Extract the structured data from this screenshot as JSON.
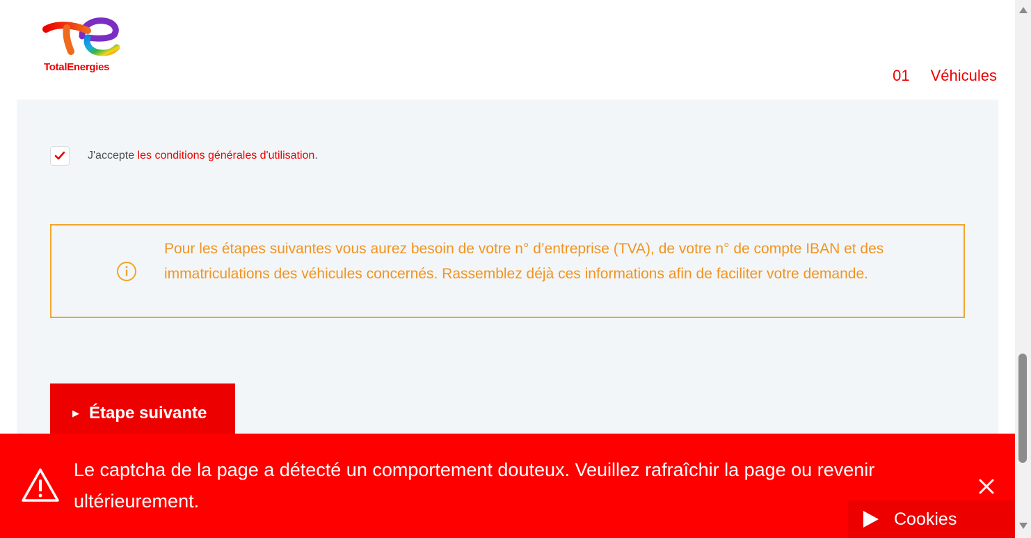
{
  "brand": {
    "name": "TotalEnergies",
    "color": "#ed0000"
  },
  "header": {
    "step_number": "01",
    "step_label": "Véhicules"
  },
  "terms": {
    "checked": true,
    "prefix": "J'accepte ",
    "link_text": "les conditions générales d'utilisation",
    "suffix": "."
  },
  "info": {
    "icon": "info-icon",
    "text": "Pour les étapes suivantes vous aurez besoin de votre n° d’entreprise (TVA), de votre n° de compte IBAN et des immatriculations des véhicules concernés. Rassemblez déjà ces informations afin de faciliter votre demande.",
    "color": "#f19420"
  },
  "next_button": {
    "label": "Étape suivante",
    "arrow": "▶"
  },
  "alert": {
    "icon": "warning-icon",
    "message": "Le captcha de la page a détecté un comportement douteux. Veuillez rafraîchir la page ou revenir ultérieurement.",
    "background": "#ff0000"
  },
  "cookies": {
    "label": "Cookies"
  }
}
